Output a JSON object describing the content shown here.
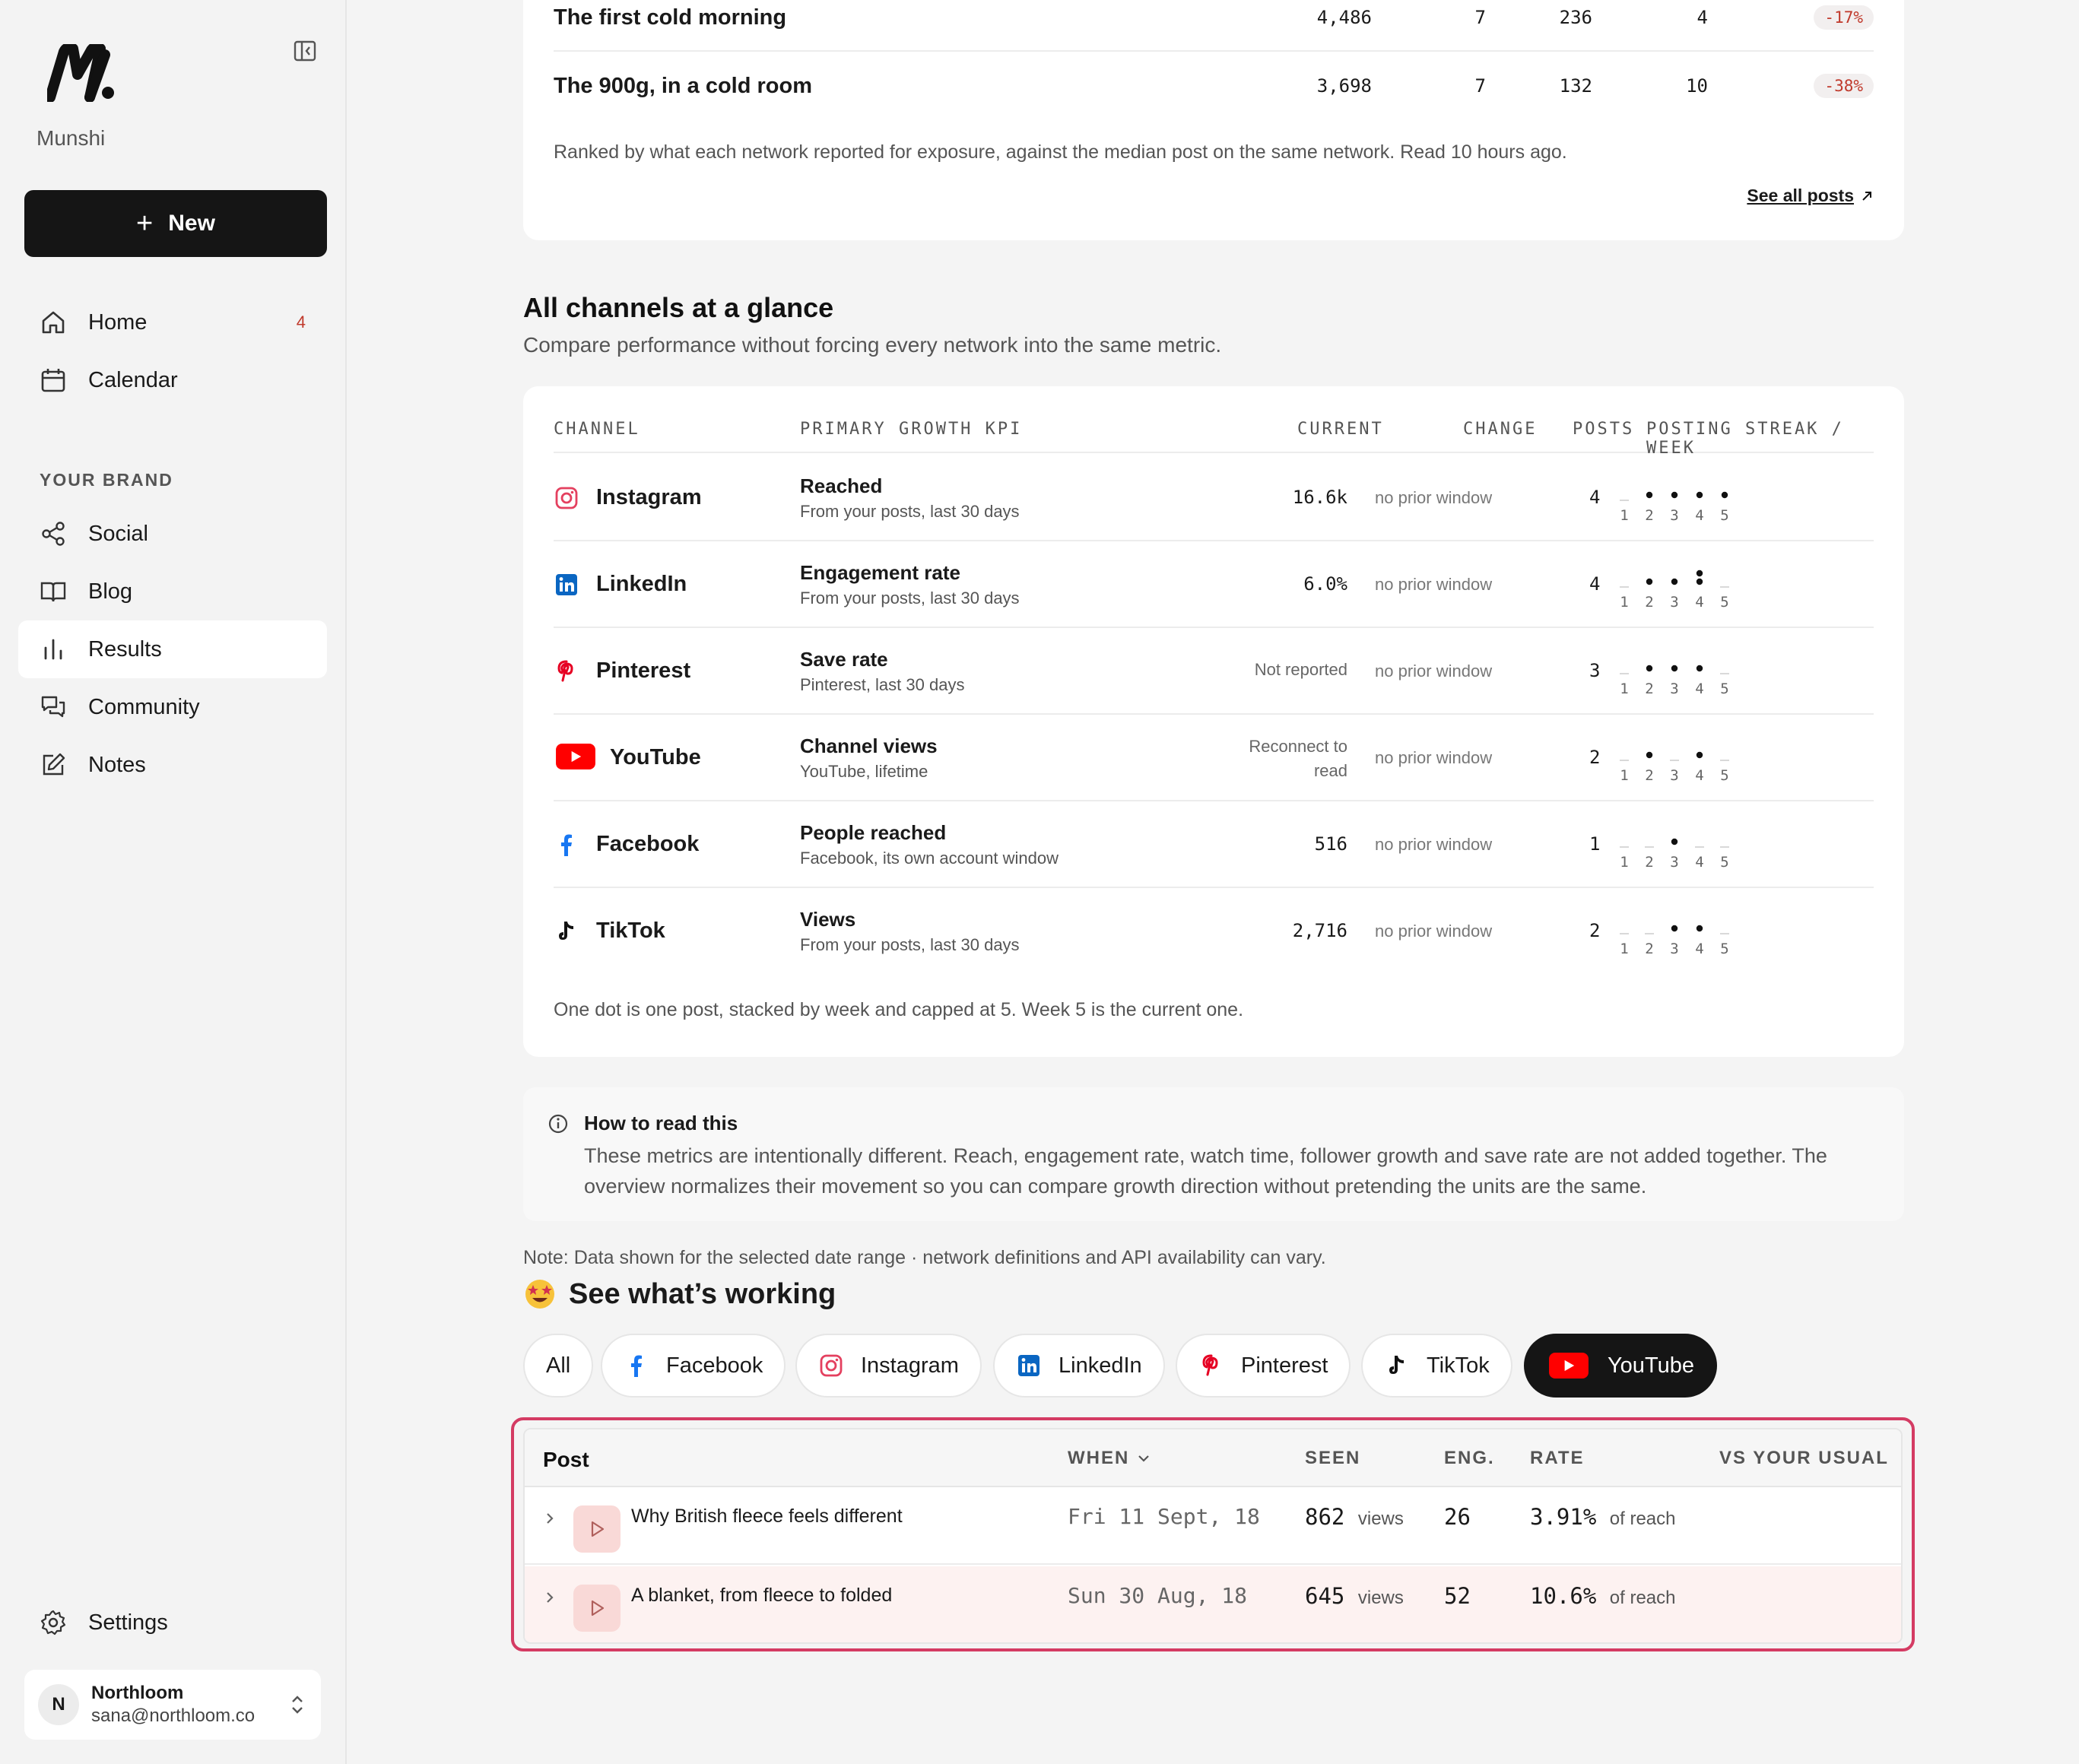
{
  "sidebar": {
    "brand": "Munshi",
    "new_label": "New",
    "nav": [
      {
        "label": "Home",
        "badge": "4"
      },
      {
        "label": "Calendar"
      }
    ],
    "section_label": "YOUR BRAND",
    "brand_nav": [
      {
        "label": "Social"
      },
      {
        "label": "Blog"
      },
      {
        "label": "Results"
      },
      {
        "label": "Community"
      },
      {
        "label": "Notes"
      }
    ],
    "settings_label": "Settings",
    "account": {
      "initial": "N",
      "name": "Northloom",
      "email": "sana@northloom.co"
    }
  },
  "top_posts": {
    "rows": [
      {
        "title": "The first cold morning",
        "v1": "4,486",
        "v2": "7",
        "v3": "236",
        "v4": "4",
        "change": "-17%"
      },
      {
        "title": "The 900g, in a cold room",
        "v1": "3,698",
        "v2": "7",
        "v3": "132",
        "v4": "10",
        "change": "-38%"
      }
    ],
    "caption": "Ranked by what each network reported for exposure, against the median post on the same network. Read 10 hours ago.",
    "see_all": "See all posts"
  },
  "channels": {
    "title": "All channels at a glance",
    "subtitle": "Compare performance without forcing every network into the same metric.",
    "headers": {
      "channel": "CHANNEL",
      "kpi": "PRIMARY GROWTH KPI",
      "current": "CURRENT",
      "change": "CHANGE",
      "posts": "POSTS",
      "streak": "POSTING STREAK / WEEK"
    },
    "week_labels": [
      "1",
      "2",
      "3",
      "4",
      "5"
    ],
    "rows": [
      {
        "name": "Instagram",
        "kpi": "Reached",
        "kpi_sub": "From your posts, last 30 days",
        "current": "16.6k",
        "change": "no prior window",
        "posts": "4",
        "streak": [
          0,
          1,
          1,
          1,
          1
        ]
      },
      {
        "name": "LinkedIn",
        "kpi": "Engagement rate",
        "kpi_sub": "From your posts, last 30 days",
        "current": "6.0%",
        "change": "no prior window",
        "posts": "4",
        "streak": [
          0,
          1,
          1,
          2,
          0
        ]
      },
      {
        "name": "Pinterest",
        "kpi": "Save rate",
        "kpi_sub": "Pinterest, last 30 days",
        "current": "Not reported",
        "change": "no prior window",
        "posts": "3",
        "streak": [
          0,
          1,
          1,
          1,
          0
        ]
      },
      {
        "name": "YouTube",
        "kpi": "Channel views",
        "kpi_sub": "YouTube, lifetime",
        "current_l1": "Reconnect to",
        "current_l2": "read",
        "change": "no prior window",
        "posts": "2",
        "streak": [
          0,
          1,
          0,
          1,
          0
        ]
      },
      {
        "name": "Facebook",
        "kpi": "People reached",
        "kpi_sub": "Facebook, its own account window",
        "current": "516",
        "change": "no prior window",
        "posts": "1",
        "streak": [
          0,
          0,
          1,
          0,
          0
        ]
      },
      {
        "name": "TikTok",
        "kpi": "Views",
        "kpi_sub": "From your posts, last 30 days",
        "current": "2,716",
        "change": "no prior window",
        "posts": "2",
        "streak": [
          0,
          0,
          1,
          1,
          0
        ]
      }
    ],
    "footnote": "One dot is one post, stacked by week and capped at 5. Week 5 is the current one."
  },
  "info": {
    "title": "How to read this",
    "body": "These metrics are intentionally different. Reach, engagement rate, watch time, follower growth and save rate are not added together. The overview normalizes their movement so you can compare growth direction without pretending the units are the same."
  },
  "note": "Note: Data shown for the selected date range · network definitions and API availability can vary.",
  "working": {
    "title": "See what’s working",
    "filters": [
      "All",
      "Facebook",
      "Instagram",
      "LinkedIn",
      "Pinterest",
      "TikTok",
      "YouTube"
    ],
    "active_filter": "YouTube",
    "headers": {
      "post": "Post",
      "when": "WHEN",
      "seen": "SEEN",
      "eng": "ENG.",
      "rate": "RATE",
      "vs": "VS YOUR USUAL"
    },
    "rows": [
      {
        "title": "Why British fleece feels different",
        "when": "Fri 11 Sept, 18",
        "seen": "862",
        "seen_unit": "views",
        "eng": "26",
        "rate": "3.91%",
        "rate_unit": "of reach"
      },
      {
        "title": "A blanket, from fleece to folded",
        "when": "Sun 30 Aug, 18",
        "seen": "645",
        "seen_unit": "views",
        "eng": "52",
        "rate": "10.6%",
        "rate_unit": "of reach"
      }
    ]
  },
  "colors": {
    "accent_dark": "#151515",
    "negative": "#c0392b",
    "highlight": "#d43b63",
    "instagram": "#e4405f",
    "linkedin": "#0a66c2",
    "pinterest": "#e60023",
    "youtube": "#ff0000",
    "facebook": "#1877f2"
  }
}
